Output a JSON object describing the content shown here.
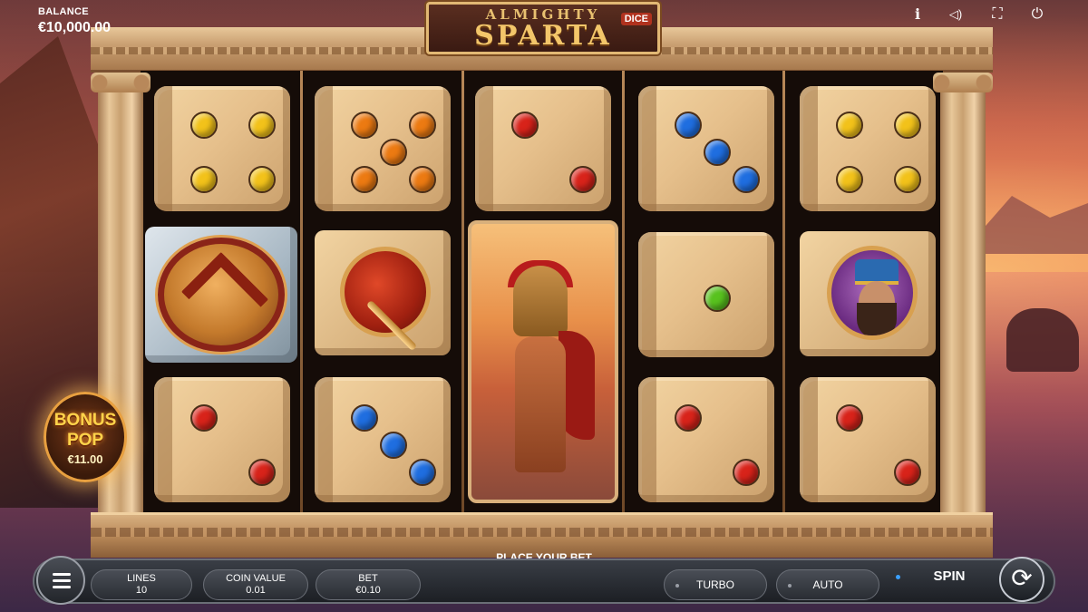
{
  "balance": {
    "label": "BALANCE",
    "value": "€10,000.00"
  },
  "logo": {
    "top": "ALMIGHTY",
    "main": "SPARTA",
    "badge": "DICE"
  },
  "top_icons": [
    "info-icon",
    "sound-icon",
    "fullscreen-icon",
    "power-icon"
  ],
  "top_glyphs": {
    "info": "i",
    "sound": "◁)",
    "fullscreen": "⛶",
    "power": "⏻"
  },
  "reels": [
    [
      "die-4-yellow",
      "shield-arrows",
      "die-2-red"
    ],
    [
      "die-5-orange",
      "spear-medal",
      "die-3-blue"
    ],
    [
      "die-2-red",
      "spartan-warrior",
      "spartan-warrior"
    ],
    [
      "die-3-blue",
      "die-1-green",
      "die-2-red"
    ],
    [
      "die-4-yellow",
      "persian-king-medal",
      "die-2-red"
    ]
  ],
  "pip_colors": {
    "yellow": "#f2c21a",
    "orange": "#ec7a12",
    "red": "#d8231a",
    "blue": "#1f6ee0",
    "green": "#58c21e"
  },
  "bonus": {
    "line1": "BONUS",
    "line2": "POP",
    "value": "€11.00"
  },
  "prompt": "PLACE YOUR BET",
  "controls": {
    "lines": {
      "label": "LINES",
      "value": "10"
    },
    "coin_value": {
      "label": "COIN VALUE",
      "value": "0.01"
    },
    "bet": {
      "label": "BET",
      "value": "€0.10"
    },
    "turbo": "TURBO",
    "auto": "AUTO",
    "spin": "SPIN",
    "spin_glyph": "⟳"
  }
}
